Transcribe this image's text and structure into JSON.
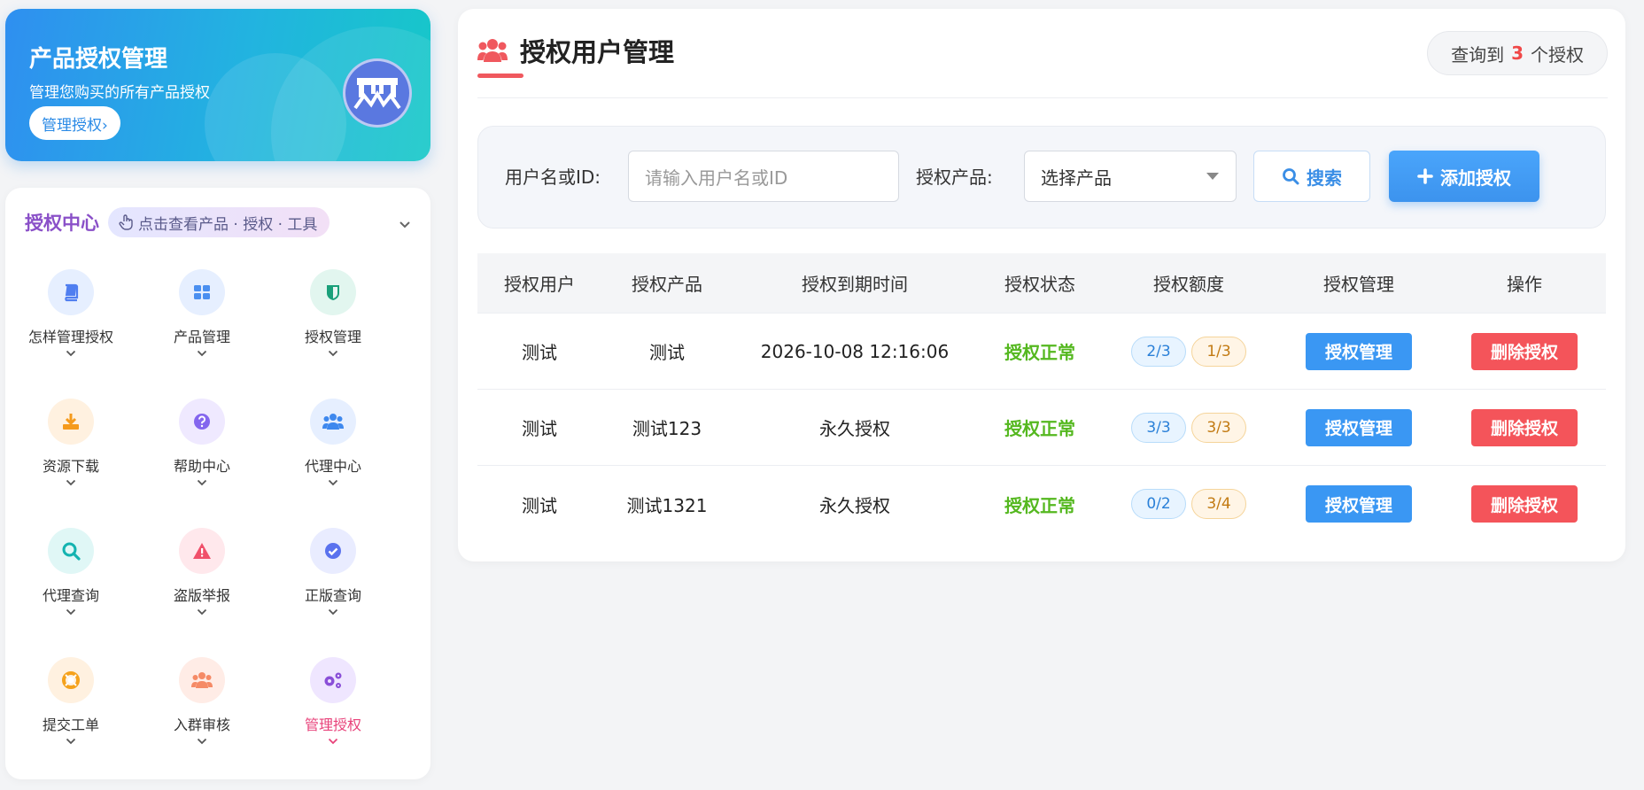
{
  "banner": {
    "title": "产品授权管理",
    "subtitle": "管理您购买的所有产品授权",
    "button_label": "管理授权›"
  },
  "nav": {
    "title": "授权中心",
    "hint": "点击查看产品 · 授权 · 工具",
    "items": [
      {
        "label": "怎样管理授权",
        "icon": "book-icon",
        "bg": "#e6efff",
        "color": "#4f7ef0"
      },
      {
        "label": "产品管理",
        "icon": "grid-icon",
        "bg": "#e6efff",
        "color": "#4a8ff0"
      },
      {
        "label": "授权管理",
        "icon": "shield-icon",
        "bg": "#e2f6ef",
        "color": "#1aa07a"
      },
      {
        "label": "资源下载",
        "icon": "download-icon",
        "bg": "#fff1e0",
        "color": "#f59a1c"
      },
      {
        "label": "帮助中心",
        "icon": "question-icon",
        "bg": "#efe9ff",
        "color": "#8466ee"
      },
      {
        "label": "代理中心",
        "icon": "users-icon",
        "bg": "#e6efff",
        "color": "#3e88ee"
      },
      {
        "label": "代理查询",
        "icon": "search-icon",
        "bg": "#e0f7f6",
        "color": "#14b3b0"
      },
      {
        "label": "盗版举报",
        "icon": "warning-icon",
        "bg": "#ffe8ec",
        "color": "#f0506a"
      },
      {
        "label": "正版查询",
        "icon": "check-badge-icon",
        "bg": "#e9ecff",
        "color": "#5a72ee"
      },
      {
        "label": "提交工单",
        "icon": "lifebuoy-icon",
        "bg": "#fff1e0",
        "color": "#f5a21c"
      },
      {
        "label": "入群审核",
        "icon": "group-icon",
        "bg": "#ffece6",
        "color": "#f58a66"
      },
      {
        "label": "管理授权",
        "icon": "gears-icon",
        "bg": "#efe6ff",
        "color": "#8a4fd8",
        "active": true
      }
    ]
  },
  "main": {
    "title": "授权用户管理",
    "result": {
      "prefix": "查询到",
      "count": "3",
      "suffix": "个授权"
    },
    "filter": {
      "user_label": "用户名或ID:",
      "user_placeholder": "请输入用户名或ID",
      "product_label": "授权产品:",
      "product_selected": "选择产品",
      "search_label": "搜索",
      "add_label": "添加授权"
    },
    "table": {
      "headers": [
        "授权用户",
        "授权产品",
        "授权到期时间",
        "授权状态",
        "授权额度",
        "授权管理",
        "操作"
      ],
      "rows": [
        {
          "user": "测试",
          "product": "测试",
          "expire": "2026-10-08 12:16:06",
          "status": "授权正常",
          "quota_a": "2/3",
          "quota_b": "1/3",
          "manage": "授权管理",
          "delete": "删除授权"
        },
        {
          "user": "测试",
          "product": "测试123",
          "expire": "永久授权",
          "status": "授权正常",
          "quota_a": "3/3",
          "quota_b": "3/3",
          "manage": "授权管理",
          "delete": "删除授权"
        },
        {
          "user": "测试",
          "product": "测试1321",
          "expire": "永久授权",
          "status": "授权正常",
          "quota_a": "0/2",
          "quota_b": "3/4",
          "manage": "授权管理",
          "delete": "删除授权"
        }
      ]
    }
  },
  "colors": {
    "accent": "#3a97f3",
    "danger": "#f4545a",
    "success": "#55b820",
    "nav_title": "#8a50c8"
  }
}
